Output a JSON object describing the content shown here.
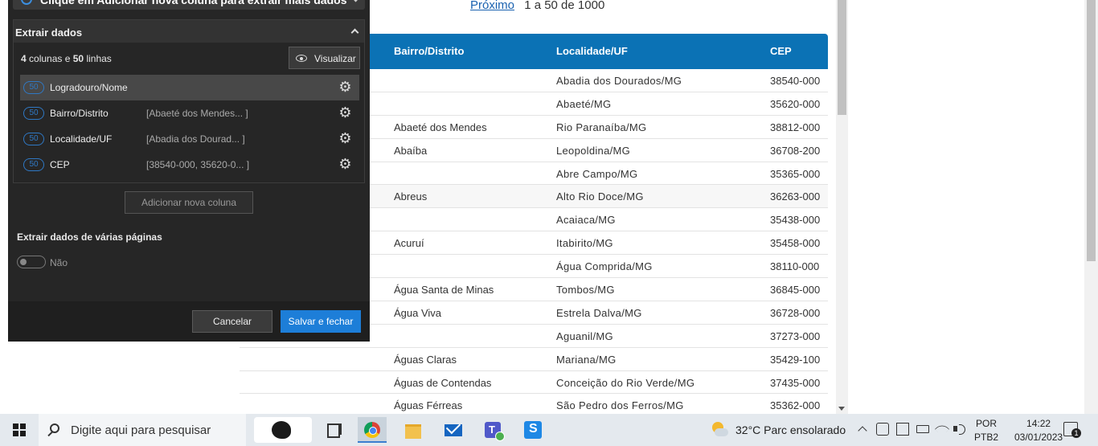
{
  "page": {
    "pager_next": "Próximo",
    "pager_range": "1 a 50 de 1000",
    "table": {
      "headers": [
        "Bairro/Distrito",
        "Localidade/UF",
        "CEP"
      ],
      "rows": [
        {
          "bairro": "",
          "localidade": "Abadia dos Dourados/MG",
          "cep": "38540-000"
        },
        {
          "bairro": "",
          "localidade": "Abaeté/MG",
          "cep": "35620-000"
        },
        {
          "bairro": "Abaeté dos Mendes",
          "localidade": "Rio Paranaíba/MG",
          "cep": "38812-000"
        },
        {
          "bairro": "Abaíba",
          "localidade": "Leopoldina/MG",
          "cep": "36708-200"
        },
        {
          "bairro": "",
          "localidade": "Abre Campo/MG",
          "cep": "35365-000"
        },
        {
          "bairro": "Abreus",
          "localidade": "Alto Rio Doce/MG",
          "cep": "36263-000"
        },
        {
          "bairro": "",
          "localidade": "Acaiaca/MG",
          "cep": "35438-000"
        },
        {
          "bairro": "Acuruí",
          "localidade": "Itabirito/MG",
          "cep": "35458-000"
        },
        {
          "bairro": "",
          "localidade": "Água Comprida/MG",
          "cep": "38110-000"
        },
        {
          "bairro": "Água Santa de Minas",
          "localidade": "Tombos/MG",
          "cep": "36845-000"
        },
        {
          "bairro": "Água Viva",
          "localidade": "Estrela Dalva/MG",
          "cep": "36728-000"
        },
        {
          "bairro": "",
          "localidade": "Aguanil/MG",
          "cep": "37273-000"
        },
        {
          "bairro": "Águas Claras",
          "localidade": "Mariana/MG",
          "cep": "35429-100"
        },
        {
          "bairro": "Águas de Contendas",
          "localidade": "Conceição do Rio Verde/MG",
          "cep": "37435-000"
        },
        {
          "bairro": "Águas Férreas",
          "localidade": "São Pedro dos Ferros/MG",
          "cep": "35362-000"
        }
      ]
    }
  },
  "panel": {
    "tip": "Clique em Adicionar nova coluna para extrair mais dados",
    "section_title": "Extrair dados",
    "summary": {
      "cols": "4",
      "cols_label": "colunas e",
      "rows": "50",
      "rows_label": "linhas"
    },
    "view_button": "Visualizar",
    "columns": [
      {
        "count": "50",
        "name": "Logradouro/Nome",
        "preview": ""
      },
      {
        "count": "50",
        "name": "Bairro/Distrito",
        "preview": "[Abaeté dos Mendes... ]"
      },
      {
        "count": "50",
        "name": "Localidade/UF",
        "preview": "[Abadia dos Dourad... ]"
      },
      {
        "count": "50",
        "name": "CEP",
        "preview": "[38540-000, 35620-0... ]"
      }
    ],
    "add_column_button": "Adicionar nova coluna",
    "multi_page_title": "Extrair dados de várias páginas",
    "multi_page_toggle": "Não",
    "cancel_button": "Cancelar",
    "save_button": "Salvar e fechar"
  },
  "taskbar": {
    "search_placeholder": "Digite aqui para pesquisar",
    "weather": "32°C  Parc ensolarado",
    "lang_1": "POR",
    "lang_2": "PTB2",
    "time": "14:22",
    "date": "03/01/2023",
    "notifications": "1"
  }
}
